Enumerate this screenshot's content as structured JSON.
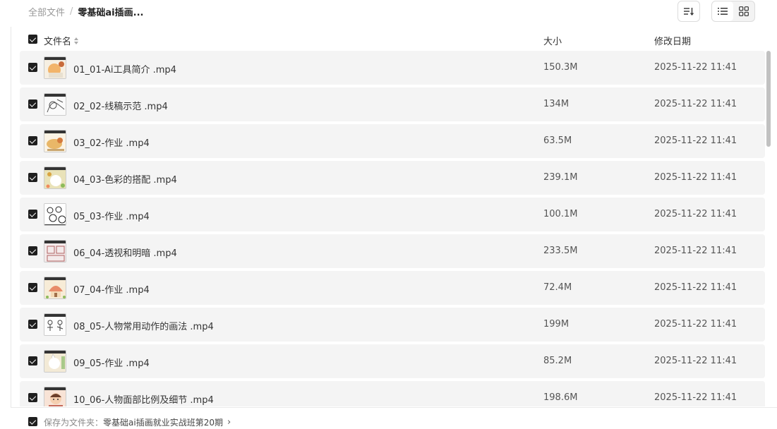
{
  "breadcrumb": {
    "root": "全部文件",
    "separator": "/",
    "current": "零基础ai插画..."
  },
  "toolbar": {
    "sort_icon": "sort-descending-icon",
    "list_view_icon": "list-view-icon",
    "grid_view_icon": "grid-view-icon"
  },
  "columns": {
    "name": "文件名",
    "size": "大小",
    "date": "修改日期"
  },
  "files": [
    {
      "name": "01_01-Ai工具简介 .mp4",
      "size": "150.3M",
      "date": "2025-11-22 11:41",
      "checked": true
    },
    {
      "name": "02_02-线稿示范 .mp4",
      "size": "134M",
      "date": "2025-11-22 11:41",
      "checked": true
    },
    {
      "name": "03_02-作业 .mp4",
      "size": "63.5M",
      "date": "2025-11-22 11:41",
      "checked": true
    },
    {
      "name": "04_03-色彩的搭配 .mp4",
      "size": "239.1M",
      "date": "2025-11-22 11:41",
      "checked": true
    },
    {
      "name": "05_03-作业 .mp4",
      "size": "100.1M",
      "date": "2025-11-22 11:41",
      "checked": true
    },
    {
      "name": "06_04-透视和明暗 .mp4",
      "size": "233.5M",
      "date": "2025-11-22 11:41",
      "checked": true
    },
    {
      "name": "07_04-作业 .mp4",
      "size": "72.4M",
      "date": "2025-11-22 11:41",
      "checked": true
    },
    {
      "name": "08_05-人物常用动作的画法 .mp4",
      "size": "199M",
      "date": "2025-11-22 11:41",
      "checked": true
    },
    {
      "name": "09_05-作业 .mp4",
      "size": "85.2M",
      "date": "2025-11-22 11:41",
      "checked": true
    },
    {
      "name": "10_06-人物面部比例及细节 .mp4",
      "size": "198.6M",
      "date": "2025-11-22 11:41",
      "checked": true
    }
  ],
  "footer": {
    "label": "保存为文件夹：",
    "folder": "零基础ai插画就业实战班第20期",
    "arrow": "›"
  },
  "colors": {
    "row_bg": "#f4f4f4",
    "checkbox": "#1f1f1f",
    "scroll_thumb": "#c1c1c1"
  }
}
